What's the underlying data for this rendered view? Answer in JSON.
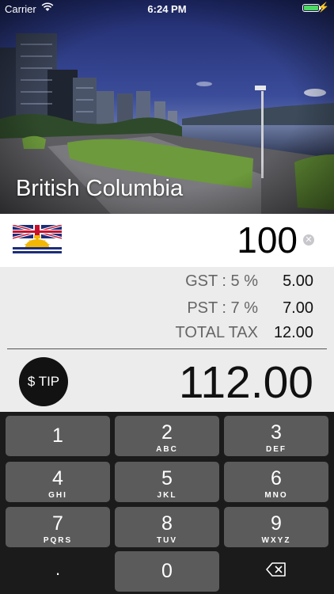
{
  "status_bar": {
    "carrier": "Carrier",
    "time": "6:24 PM",
    "battery_level": 1.0
  },
  "region": {
    "name": "British Columbia"
  },
  "amount": {
    "value": "100"
  },
  "taxes": [
    {
      "label": "GST : 5 %",
      "value": "5.00"
    },
    {
      "label": "PST : 7 %",
      "value": "7.00"
    },
    {
      "label": "TOTAL TAX",
      "value": "12.00"
    }
  ],
  "tip_button": {
    "label": "$ TIP"
  },
  "total": {
    "value": "112.00"
  },
  "keypad": {
    "keys": [
      {
        "num": "1",
        "letters": ""
      },
      {
        "num": "2",
        "letters": "ABC"
      },
      {
        "num": "3",
        "letters": "DEF"
      },
      {
        "num": "4",
        "letters": "GHI"
      },
      {
        "num": "5",
        "letters": "JKL"
      },
      {
        "num": "6",
        "letters": "MNO"
      },
      {
        "num": "7",
        "letters": "PQRS"
      },
      {
        "num": "8",
        "letters": "TUV"
      },
      {
        "num": "9",
        "letters": "WXYZ"
      },
      {
        "num": ".",
        "letters": ""
      },
      {
        "num": "0",
        "letters": ""
      }
    ]
  },
  "icons": [
    "wifi-icon",
    "battery-icon",
    "charging-icon",
    "clear-icon",
    "backspace-icon",
    "bc-flag-icon"
  ],
  "colors": {
    "battery": "#4cd964",
    "keypad_bg": "#1b1b1b",
    "key_bg": "#5b5b5b",
    "tax_panel_bg": "#ececec"
  }
}
